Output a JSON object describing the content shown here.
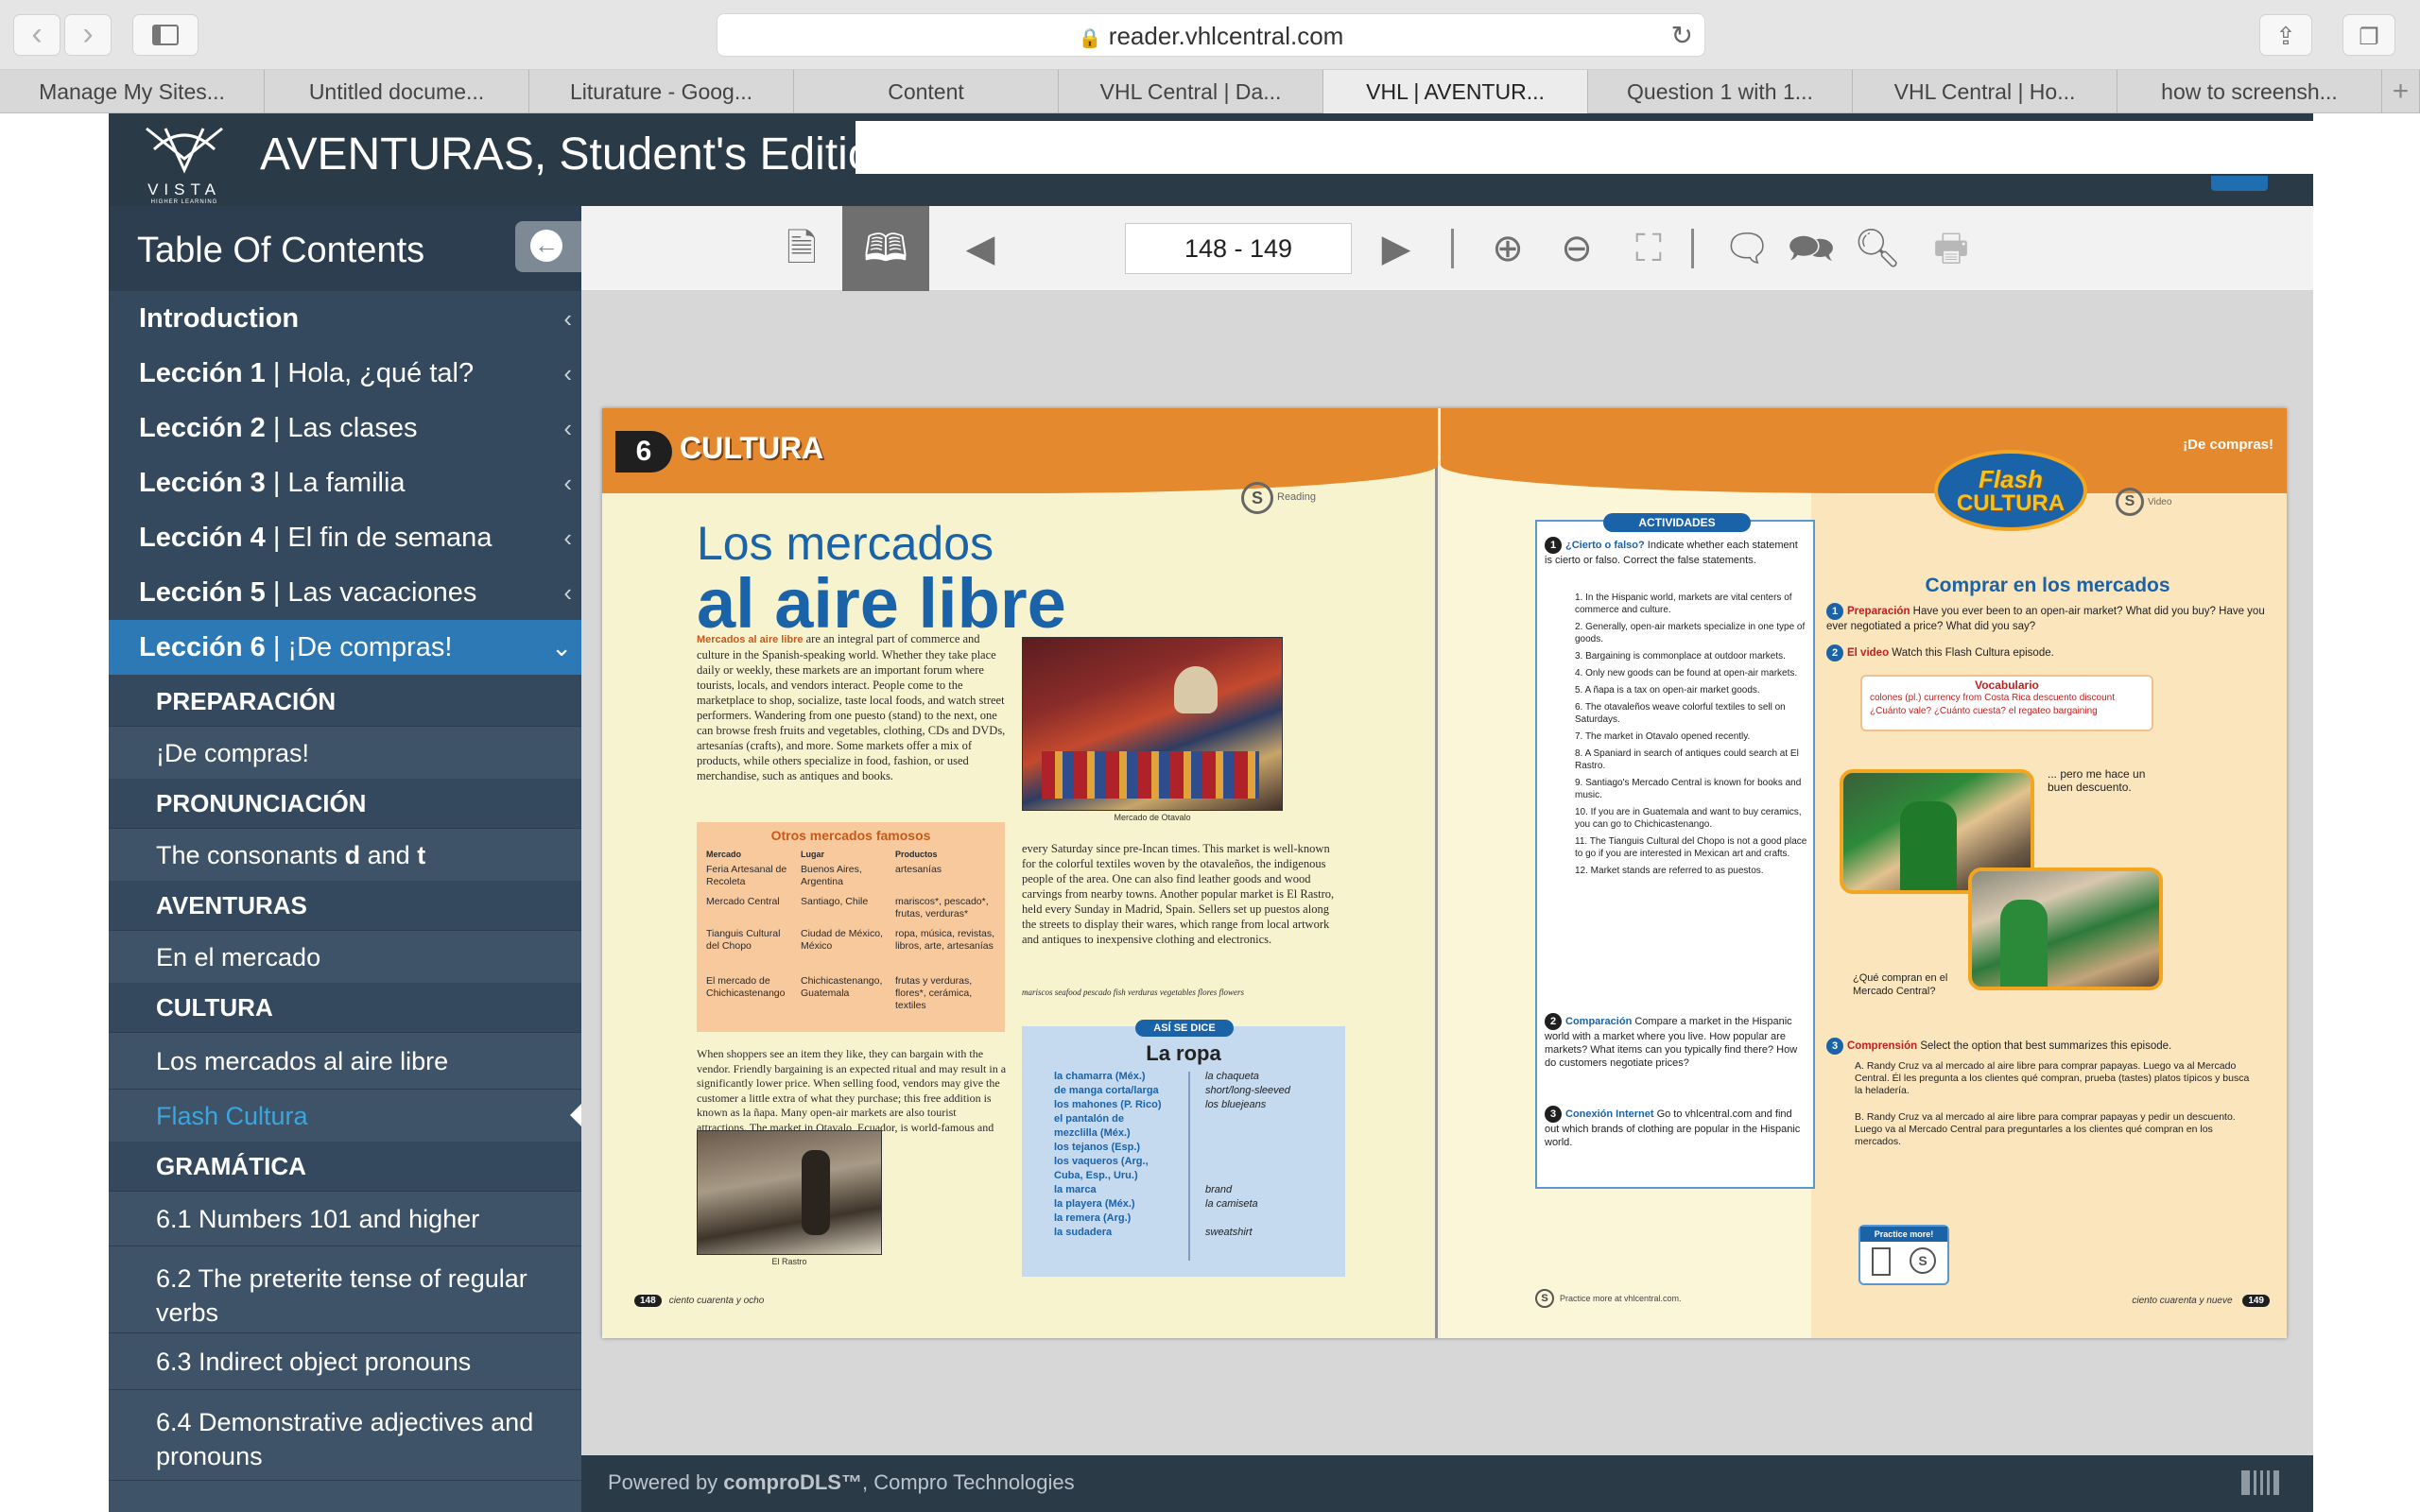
{
  "browser": {
    "url": "reader.vhlcentral.com",
    "tabs": [
      "Manage My Sites...",
      "Untitled docume...",
      "Liturature - Goog...",
      "Content",
      "VHL Central | Da...",
      "VHL | AVENTUR...",
      "Question 1 with 1...",
      "VHL Central | Ho...",
      "how to screensh..."
    ],
    "new_tab": "+"
  },
  "app": {
    "title": "AVENTURAS, Student's Edition",
    "logo_text": "VISTA",
    "logo_sub": "HIGHER LEARNING"
  },
  "toc": {
    "title": "Table Of Contents",
    "chapters": [
      {
        "bold": "Introduction",
        "rest": ""
      },
      {
        "bold": "Lección 1",
        "rest": " | Hola, ¿qué tal?"
      },
      {
        "bold": "Lección 2",
        "rest": " | Las clases"
      },
      {
        "bold": "Lección 3",
        "rest": " | La familia"
      },
      {
        "bold": "Lección 4",
        "rest": " | El fin de semana"
      },
      {
        "bold": "Lección 5",
        "rest": " | Las vacaciones"
      },
      {
        "bold": "Lección 6",
        "rest": " | ¡De compras!"
      }
    ],
    "sections": [
      "PREPARACIÓN",
      "PRONUNCIACIÓN",
      "AVENTURAS",
      "CULTURA",
      "GRAMÁTICA"
    ],
    "items": {
      "prep": "¡De compras!",
      "pron_a": "The consonants ",
      "pron_d": "d",
      "pron_and": " and ",
      "pron_t": "t",
      "aventuras": "En el mercado",
      "cultura1": "Los mercados al aire libre",
      "cultura2": "Flash Cultura",
      "g1": "6.1 Numbers 101 and higher",
      "g2": "6.2 The preterite tense of regular verbs",
      "g3": "6.3 Indirect object pronouns",
      "g4": "6.4 Demonstrative adjectives and pronouns"
    }
  },
  "toolbar": {
    "page": "148 - 149"
  },
  "footer": {
    "prefix": "Powered by ",
    "brand": "comproDLS™",
    "suffix": ", Compro Technologies"
  },
  "book": {
    "left": {
      "chapter_number": "6",
      "section": "CULTURA",
      "icon_label": "Reading",
      "title_line1": "Los mercados",
      "title_line2": "al aire libre",
      "intro_bold": "Mercados al aire libre",
      "intro": " are an integral part of commerce and culture in the Spanish-speaking world. Whether they take place daily or weekly, these markets are an important forum where tourists, locals, and vendors interact. People come to the marketplace to shop, socialize, taste local foods, and watch street performers. Wandering from one puesto (stand) to the next, one can browse fresh fruits and vegetables, clothing, CDs and DVDs, artesanías (crafts), and more. Some markets offer a mix of products, while others specialize in food, fashion, or used merchandise, such as antiques and books.",
      "photo_caption": "Mercado de Otavalo",
      "col2": "every Saturday since pre-Incan times. This market is well-known for the colorful textiles woven by the otavaleños, the indigenous people of the area. One can also find leather goods and wood carvings from nearby towns. Another popular market is El Rastro, held every Sunday in Madrid, Spain. Sellers set up puestos along the streets to display their wares, which range from local artwork and antiques to inexpensive clothing and electronics.",
      "gloss": "mariscos seafood  pescado fish  verduras vegetables  flores flowers",
      "col1b": "When shoppers see an item they like, they can bargain with the vendor. Friendly bargaining is an expected ritual and may result in a significantly lower price. When selling food, vendors may give the customer a little extra of what they purchase; this free addition is known as la ñapa. Many open-air markets are also tourist attractions. The market in Otavalo, Ecuador, is world-famous and has taken place",
      "photo2_caption": "El Rastro",
      "otros_title": "Otros mercados famosos",
      "otros_headers": [
        "Mercado",
        "Lugar",
        "Productos"
      ],
      "otros_rows": [
        [
          "Feria Artesanal de Recoleta",
          "Buenos Aires, Argentina",
          "artesanías"
        ],
        [
          "Mercado Central",
          "Santiago, Chile",
          "mariscos*, pescado*, frutas, verduras*"
        ],
        [
          "Tianguis Cultural del Chopo",
          "Ciudad de México, México",
          "ropa, música, revistas, libros, arte, artesanías"
        ],
        [
          "El mercado de Chichicastenango",
          "Chichicastenango, Guatemala",
          "frutas y verduras, flores*, cerámica, textiles"
        ]
      ],
      "asise_pill": "ASÍ SE DICE",
      "asise_title": "La ropa",
      "vocab_left": "la chamarra (Méx.)\nde manga corta/larga\nlos mahones (P. Rico)\nel pantalón de\n  mezclilla (Méx.)\nlos tejanos (Esp.)\nlos vaqueros (Arg.,\n  Cuba, Esp., Uru.)\nla marca\nla playera (Méx.)\nla remera (Arg.)\nla sudadera",
      "vocab_right": "la chaqueta\nshort/long-sleeved\nlos bluejeans\n\n\n\n\n\nbrand\nla camiseta\n\nsweatshirt",
      "page_num": "148",
      "page_words": "ciento cuarenta y ocho"
    },
    "right": {
      "header": "¡De compras!",
      "act_pill": "ACTIVIDADES",
      "q1_title": "¿Cierto o falso?",
      "q1_text": " Indicate whether each statement is cierto or falso. Correct the false statements.",
      "q1_items": [
        "1. In the Hispanic world, markets are vital centers of commerce and culture.",
        "2. Generally, open-air markets specialize in one type of goods.",
        "3. Bargaining is commonplace at outdoor markets.",
        "4. Only new goods can be found at open-air markets.",
        "5. A ñapa is a tax on open-air market goods.",
        "6. The otavaleños weave colorful textiles to sell on Saturdays.",
        "7. The market in Otavalo opened recently.",
        "8. A Spaniard in search of antiques could search at El Rastro.",
        "9. Santiago's Mercado Central is known for books and music.",
        "10. If you are in Guatemala and want to buy ceramics, you can go to Chichicastenango.",
        "11. The Tianguis Cultural del Chopo is not a good place to go if you are interested in Mexican art and crafts.",
        "12. Market stands are referred to as puestos."
      ],
      "q2_title": "Comparación",
      "q2_text": " Compare a market in the Hispanic world with a market where you live. How popular are markets? What items can you typically find there? How do customers negotiate prices?",
      "q3_title": "Conexión Internet",
      "q3_text": " Go to vhlcentral.com and find out which brands of clothing are popular in the Hispanic world.",
      "practice_footer": "Practice more at vhlcentral.com.",
      "flash_line1": "Flash",
      "flash_line2": "CULTURA",
      "video_label": "Video",
      "fc_title": "Comprar en los mercados",
      "p1_title": "Preparación",
      "p1_text": " Have you ever been to an open-air market? What did you buy? Have you ever negotiated a price? What did you say?",
      "p2_title": "El video",
      "p2_text": " Watch this Flash Cultura episode.",
      "vocab_title": "Vocabulario",
      "vocab": "colones (pl.) currency from Costa Rica    descuento discount\n¿Cuánto vale? ¿Cuánto cuesta?    el regateo bargaining",
      "cap1": "... pero me hace un buen descuento.",
      "cap2": "¿Qué compran en el Mercado Central?",
      "p3_title": "Comprensión",
      "p3_text": " Select the option that best summarizes this episode.",
      "p3_a": "A. Randy Cruz va al mercado al aire libre para comprar papayas. Luego va al Mercado Central. Él les pregunta a los clientes qué compran, prueba (tastes) platos típicos y busca la heladería.",
      "p3_b": "B. Randy Cruz va al mercado al aire libre para comprar papayas y pedir un descuento. Luego va al Mercado Central para preguntarles a los clientes qué compran en los mercados.",
      "practice_title": "Practice more!",
      "page_num": "149",
      "page_words": "ciento cuarenta y nueve"
    }
  }
}
